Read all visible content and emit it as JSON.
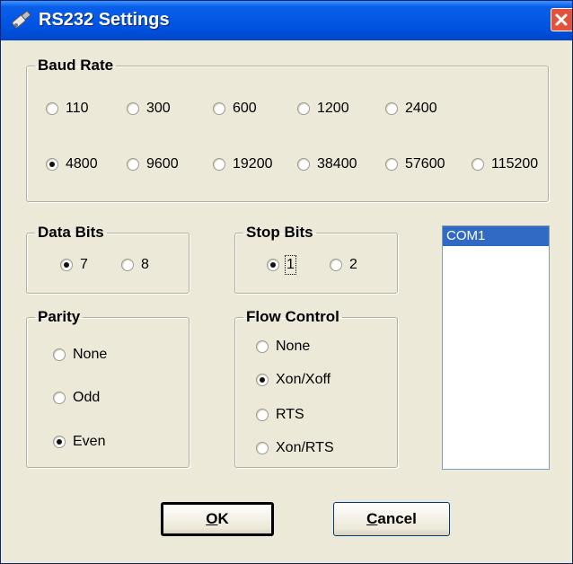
{
  "window": {
    "title": "RS232 Settings"
  },
  "baud_rate": {
    "legend": "Baud Rate",
    "options": [
      "110",
      "300",
      "600",
      "1200",
      "2400",
      "4800",
      "9600",
      "19200",
      "38400",
      "57600",
      "115200"
    ],
    "selected": "4800"
  },
  "data_bits": {
    "legend": "Data Bits",
    "options": [
      "7",
      "8"
    ],
    "selected": "7"
  },
  "stop_bits": {
    "legend": "Stop Bits",
    "options": [
      "1",
      "2"
    ],
    "selected": "1"
  },
  "parity": {
    "legend": "Parity",
    "options": [
      "None",
      "Odd",
      "Even"
    ],
    "selected": "Even"
  },
  "flow_control": {
    "legend": "Flow Control",
    "options": [
      "None",
      "Xon/Xoff",
      "RTS",
      "Xon/RTS"
    ],
    "selected": "Xon/Xoff"
  },
  "ports": {
    "items": [
      "COM1"
    ],
    "selected": "COM1"
  },
  "buttons": {
    "ok_accel": "O",
    "ok_rest": "K",
    "cancel_accel": "C",
    "cancel_rest": "ancel"
  },
  "colors": {
    "titlebar": "#0054e3",
    "selection": "#316ac5",
    "dialog_bg": "#ece9d8"
  }
}
